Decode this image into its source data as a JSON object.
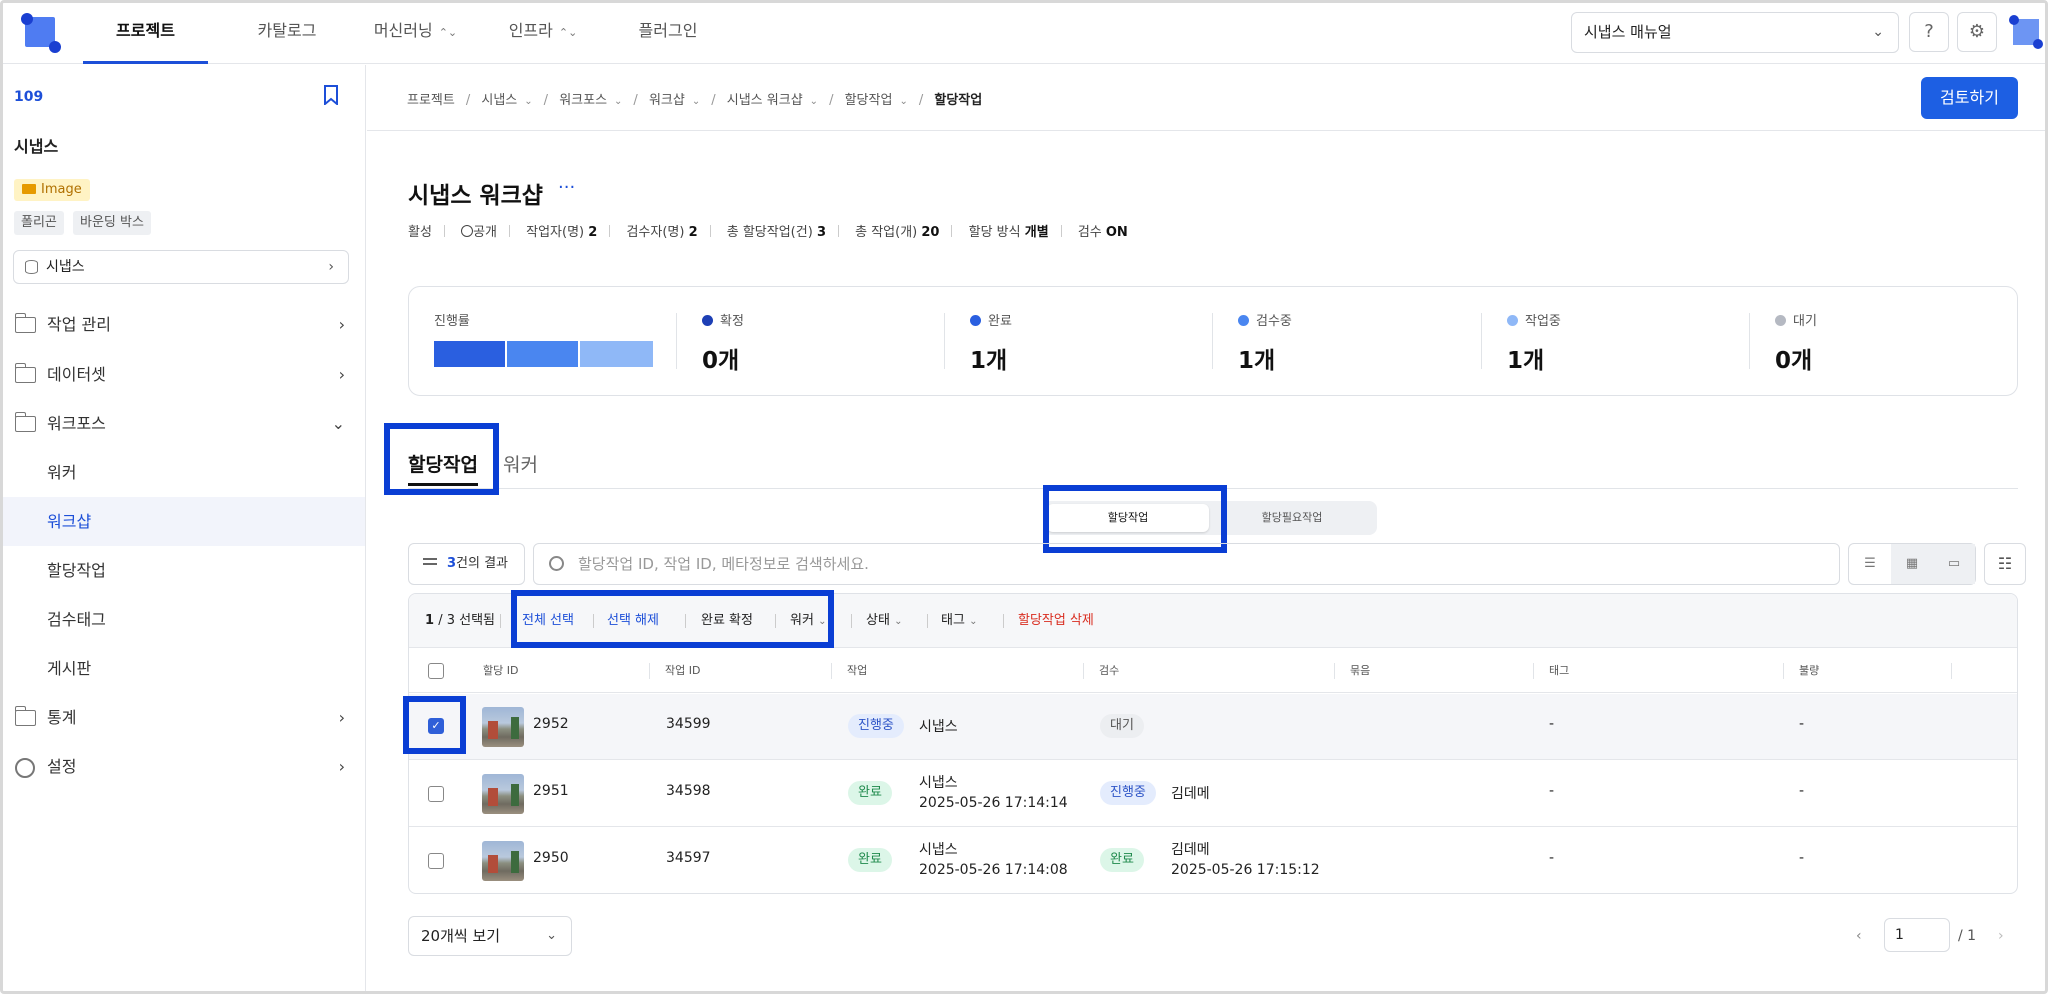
{
  "topnav": {
    "items": [
      "프로젝트",
      "카탈로그",
      "머신러닝",
      "인프라",
      "플러그인"
    ],
    "manual_select": "시냅스 매뉴얼",
    "help_icon": "?",
    "settings_icon": "gear"
  },
  "sidebar": {
    "project_id": "109",
    "project_name": "시냅스",
    "type_badge": "Image",
    "tags": [
      "폴리곤",
      "바운딩 박스"
    ],
    "dataset_select": "시냅스",
    "menu": [
      {
        "label": "작업 관리"
      },
      {
        "label": "데이터셋"
      },
      {
        "label": "워크포스"
      },
      {
        "label": "통계"
      },
      {
        "label": "설정"
      }
    ],
    "submenu": [
      "워커",
      "워크샵",
      "할당작업",
      "검수태그",
      "게시판"
    ]
  },
  "breadcrumb": [
    "프로젝트",
    "시냅스",
    "워크포스",
    "워크샵",
    "시냅스 워크샵",
    "할당작업",
    "할당작업"
  ],
  "review_button": "검토하기",
  "page": {
    "title": "시냅스 워크샵",
    "more": "···",
    "status": "활성",
    "visibility": "공개",
    "workers_label": "작업자(명)",
    "workers": "2",
    "reviewers_label": "검수자(명)",
    "reviewers": "2",
    "assignments_label": "총 할당작업(건)",
    "assignments": "3",
    "tasks_label": "총 작업(개)",
    "tasks": "20",
    "assign_method_label": "할당 방식",
    "assign_method": "개별",
    "review_label": "검수",
    "review": "ON"
  },
  "stats": {
    "progress_label": "진행률",
    "items": [
      {
        "label": "확정",
        "value": "0개",
        "color": "#1d3fb5"
      },
      {
        "label": "완료",
        "value": "1개",
        "color": "#2a5fe0"
      },
      {
        "label": "검수중",
        "value": "1개",
        "color": "#4a86f0"
      },
      {
        "label": "작업중",
        "value": "1개",
        "color": "#8fb8f7"
      },
      {
        "label": "대기",
        "value": "0개",
        "color": "#b5b9c2"
      }
    ]
  },
  "tabs": [
    "할당작업",
    "워커"
  ],
  "segment": [
    "할당작업",
    "할당필요작업"
  ],
  "filter": {
    "count": "3",
    "suffix": "건의 결과"
  },
  "search_placeholder": "할당작업 ID, 작업 ID, 메타정보로 검색하세요.",
  "toolbar": {
    "selected_num": "1",
    "selected_total": "/ 3 선택됨",
    "select_all": "전체 선택",
    "deselect": "선택 해제",
    "confirm_done": "완료 확정",
    "worker": "워커",
    "status": "상태",
    "tag": "태그",
    "delete": "할당작업 삭제"
  },
  "columns": [
    "할당 ID",
    "작업 ID",
    "작업",
    "검수",
    "묶음",
    "태그",
    "불량"
  ],
  "rows": [
    {
      "checked": true,
      "assign_id": "2952",
      "task_id": "34599",
      "work_status": "진행중",
      "work_user": "시냅스",
      "work_time": "",
      "review_status": "대기",
      "review_user": "",
      "review_time": "",
      "tag": "-",
      "defect": "-"
    },
    {
      "checked": false,
      "assign_id": "2951",
      "task_id": "34598",
      "work_status": "완료",
      "work_user": "시냅스",
      "work_time": "2025-05-26 17:14:14",
      "review_status": "진행중",
      "review_user": "김데메",
      "review_time": "",
      "tag": "-",
      "defect": "-"
    },
    {
      "checked": false,
      "assign_id": "2950",
      "task_id": "34597",
      "work_status": "완료",
      "work_user": "시냅스",
      "work_time": "2025-05-26 17:14:08",
      "review_status": "완료",
      "review_user": "김데메",
      "review_time": "2025-05-26 17:15:12",
      "tag": "-",
      "defect": "-"
    }
  ],
  "pagination": {
    "page_size": "20개씩 보기",
    "current": "1",
    "total": "/ 1"
  }
}
